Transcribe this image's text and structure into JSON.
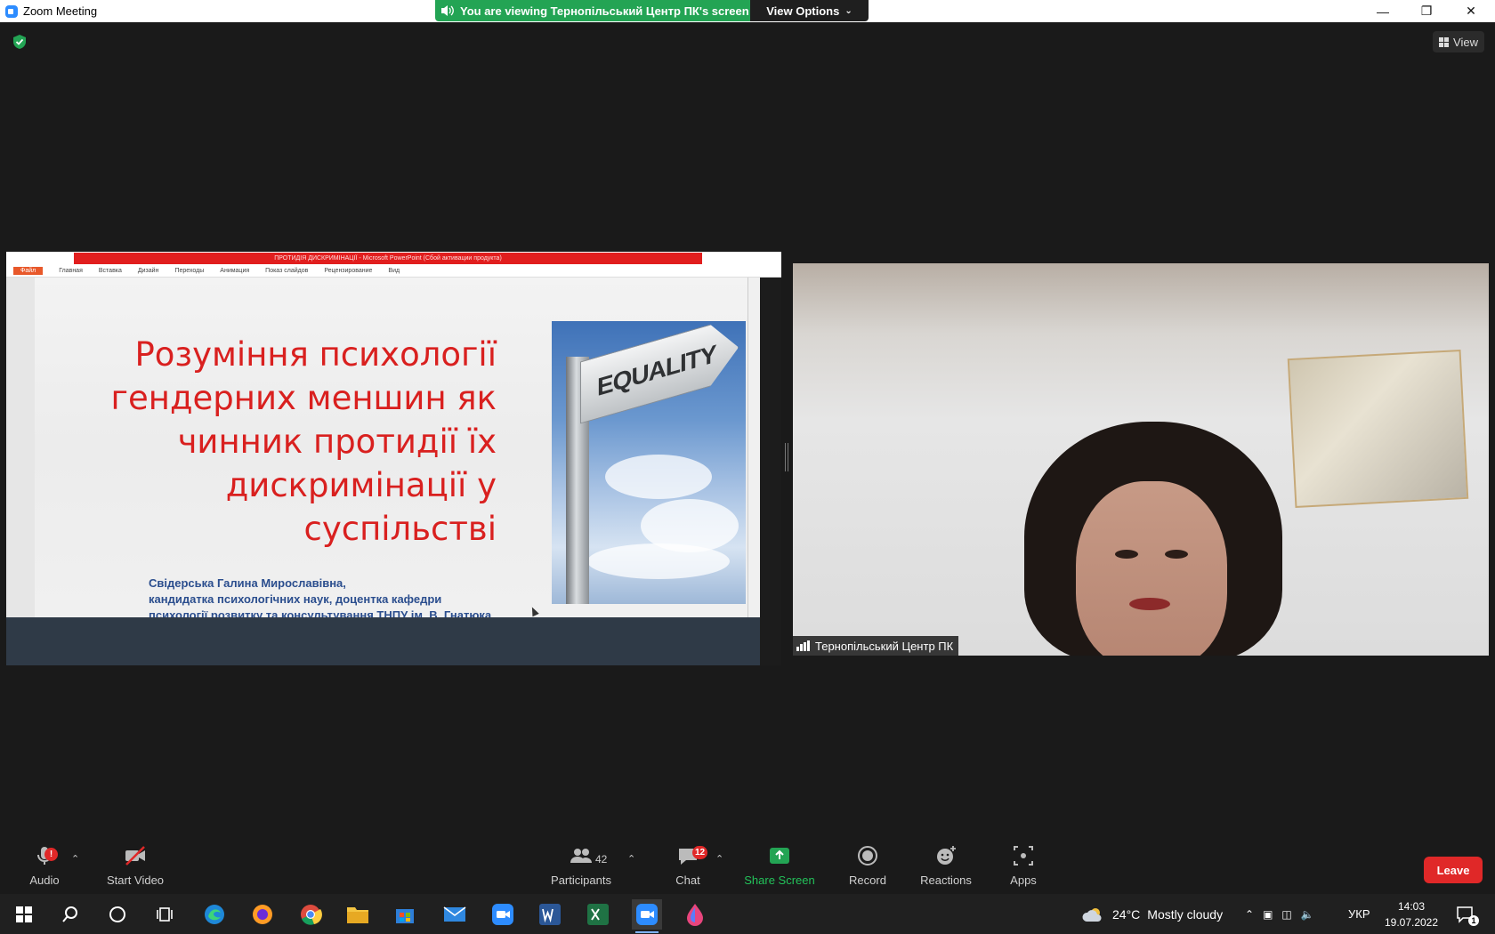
{
  "window": {
    "title": "Zoom Meeting"
  },
  "banner": {
    "viewing_text": "You are viewing Тернопільський Центр ПК's screen",
    "view_options": "View Options"
  },
  "header": {
    "view_label": "View"
  },
  "shared_screen": {
    "ppt_title": "ПРОТИДІЯ ДИСКРИМІНАЦІЇ - Microsoft PowerPoint (Сбой активации продукта)",
    "ribbon_tabs": [
      "Файл",
      "Главная",
      "Вставка",
      "Дизайн",
      "Переходы",
      "Анимация",
      "Показ слайдов",
      "Рецензирование",
      "Вид"
    ],
    "slide_title_lines": [
      "Розуміння психології",
      "гендерних меншин як",
      "чинник протидії їх",
      "дискримінації у суспільстві"
    ],
    "author_lines": [
      "Свідерська Галина Мирославівна,",
      "кандидатка психологічних наук, доцентка кафедри",
      "психології розвитку та консультування ТНПУ ім. В. Гнатюка"
    ],
    "sign_text": "EQUALITY"
  },
  "video": {
    "participant_name": "Тернопільський Центр ПК"
  },
  "toolbar": {
    "audio": "Audio",
    "audio_badge": "!",
    "start_video": "Start Video",
    "participants": "Participants",
    "participants_count": "42",
    "chat": "Chat",
    "chat_badge": "12",
    "share_screen": "Share Screen",
    "record": "Record",
    "reactions": "Reactions",
    "apps": "Apps",
    "leave": "Leave"
  },
  "taskbar": {
    "weather_temp": "24°C",
    "weather_desc": "Mostly cloudy",
    "language": "УКР",
    "time": "14:03",
    "date": "19.07.2022",
    "notif_count": "1"
  },
  "colors": {
    "accent_green": "#23a454",
    "leave_red": "#e02828",
    "slide_title_red": "#d9201f",
    "author_blue": "#2b4e8e"
  }
}
